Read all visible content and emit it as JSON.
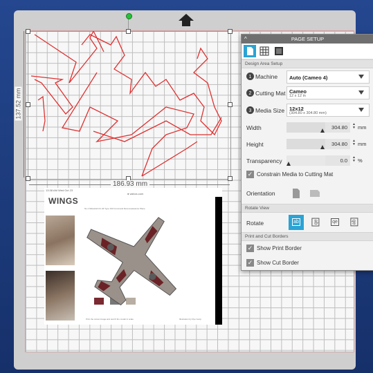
{
  "canvas": {
    "width_label": "186.93 mm",
    "height_label": "137.52 mm",
    "photo": {
      "header_text": "13:38 AM   Wed Oct 23",
      "url_text": "● wsbcs.com",
      "title": "WINGS",
      "subtitle": "No.1 Mitsubishi Ki-46 Type 100 Command Reconnaissance Plane",
      "caption_left": "Print the cutout image and test fit the model in scale",
      "caption_right": "Illustration by Ryo Gunji"
    }
  },
  "panel": {
    "title": "PAGE SETUP",
    "sections": {
      "design_area": "Design Area Setup",
      "rotate_view": "Rotate View",
      "print_cut": "Print and Cut Borders"
    },
    "machine": {
      "step": "1",
      "label": "Machine",
      "value": "Auto (Cameo 4)"
    },
    "cutting_mat": {
      "step": "2",
      "label": "Cutting Mat",
      "value": "Cameo",
      "detail": "12 x 12 in"
    },
    "media_size": {
      "step": "3",
      "label": "Media Size",
      "value": "12x12",
      "detail": "(304.80 x 304.80 mm)"
    },
    "width": {
      "label": "Width",
      "value": "304.80",
      "unit": "mm"
    },
    "height": {
      "label": "Height",
      "value": "304.80",
      "unit": "mm"
    },
    "transparency": {
      "label": "Transparency",
      "value": "0.0",
      "unit": "%"
    },
    "constrain": {
      "label": "Constrain Media to Cutting Mat",
      "checked": true
    },
    "orientation": {
      "label": "Orientation"
    },
    "rotate": {
      "label": "Rotate",
      "options": [
        "ab",
        "ab",
        "qe",
        "ab"
      ]
    },
    "show_print_border": {
      "label": "Show Print Border",
      "checked": true
    },
    "show_cut_border": {
      "label": "Show Cut Border",
      "checked": true
    }
  },
  "colors": {
    "accent": "#2ba3d4",
    "cut_line": "#e03030",
    "mat": "#cfcfcf",
    "background": "#1d3a78"
  },
  "icons": [
    "up-arrow-icon",
    "page-icon",
    "grid-icon",
    "mat-icon",
    "portrait-icon",
    "landscape-icon",
    "check-icon",
    "dropdown-icon"
  ]
}
